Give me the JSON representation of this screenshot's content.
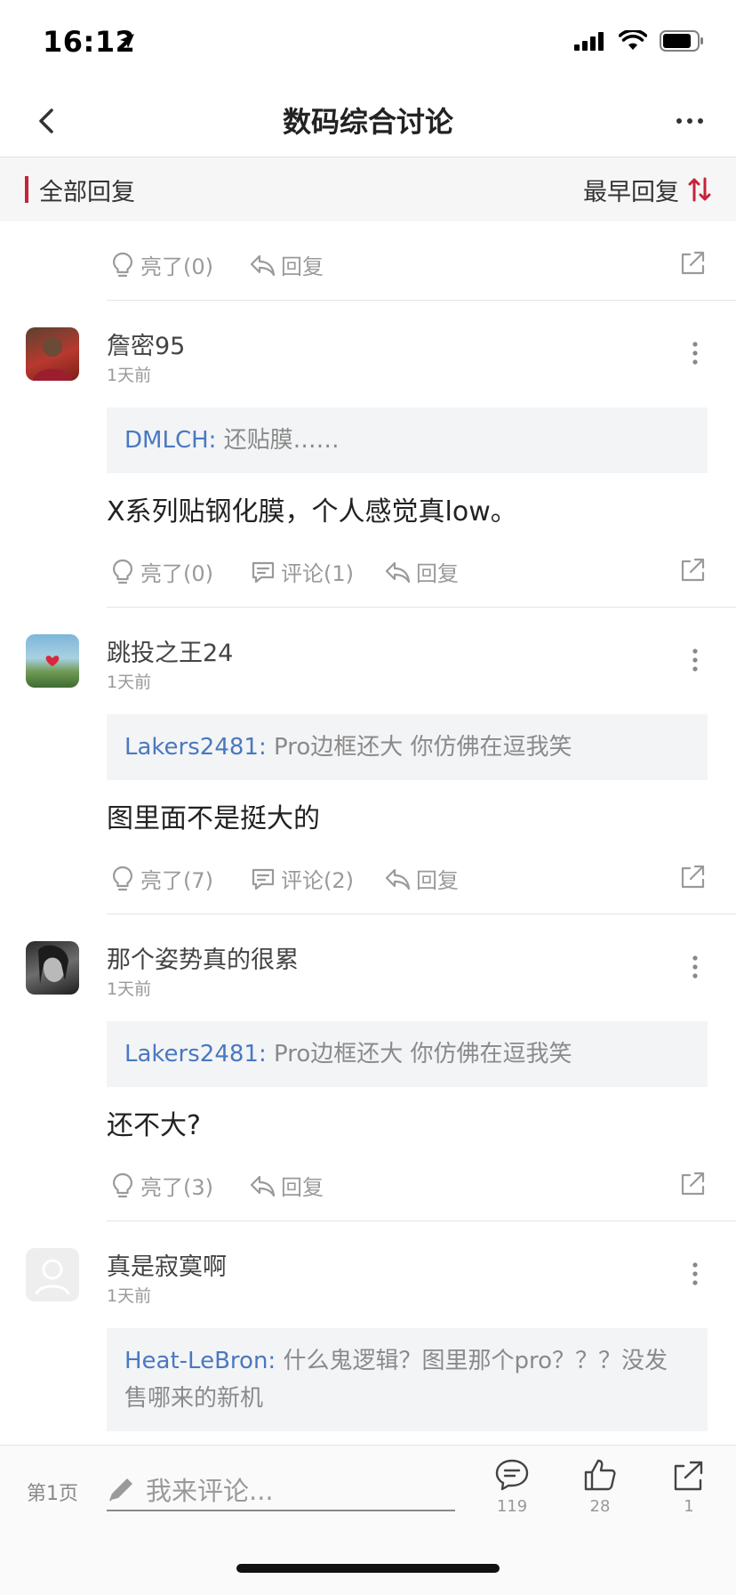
{
  "status_bar": {
    "time": "16:12"
  },
  "nav": {
    "title": "数码综合讨论"
  },
  "filter": {
    "title": "全部回复",
    "sort_label": "最早回复"
  },
  "top_actions": {
    "like": "亮了(0)",
    "reply": "回复"
  },
  "comments": [
    {
      "username": "詹密95",
      "time": "1天前",
      "quote_user": "DMLCH:",
      "quote_text": " 还贴膜……",
      "text": "X系列贴钢化膜，个人感觉真low。",
      "like": "亮了(0)",
      "comment": "评论(1)",
      "reply": "回复"
    },
    {
      "username": "跳投之王24",
      "time": "1天前",
      "quote_user": "Lakers2481:",
      "quote_text": " Pro边框还大 你仿佛在逗我笑",
      "text": "图里面不是挺大的",
      "like": "亮了(7)",
      "comment": "评论(2)",
      "reply": "回复"
    },
    {
      "username": "那个姿势真的很累",
      "time": "1天前",
      "quote_user": "Lakers2481:",
      "quote_text": " Pro边框还大 你仿佛在逗我笑",
      "text": "还不大?",
      "like": "亮了(3)",
      "reply": "回复"
    },
    {
      "username": "真是寂寞啊",
      "time": "1天前",
      "quote_user": "Heat-LeBron:",
      "quote_text": " 什么鬼逻辑？图里那个pro？？？没发售哪来的新机"
    }
  ],
  "bottom_bar": {
    "page_label": "第1页",
    "comment_placeholder": "我来评论...",
    "comments_count": "119",
    "likes_count": "28",
    "shares_count": "1"
  },
  "colors": {
    "accent": "#c5233a",
    "link": "#4a78c0",
    "muted": "#9a9a9a"
  }
}
